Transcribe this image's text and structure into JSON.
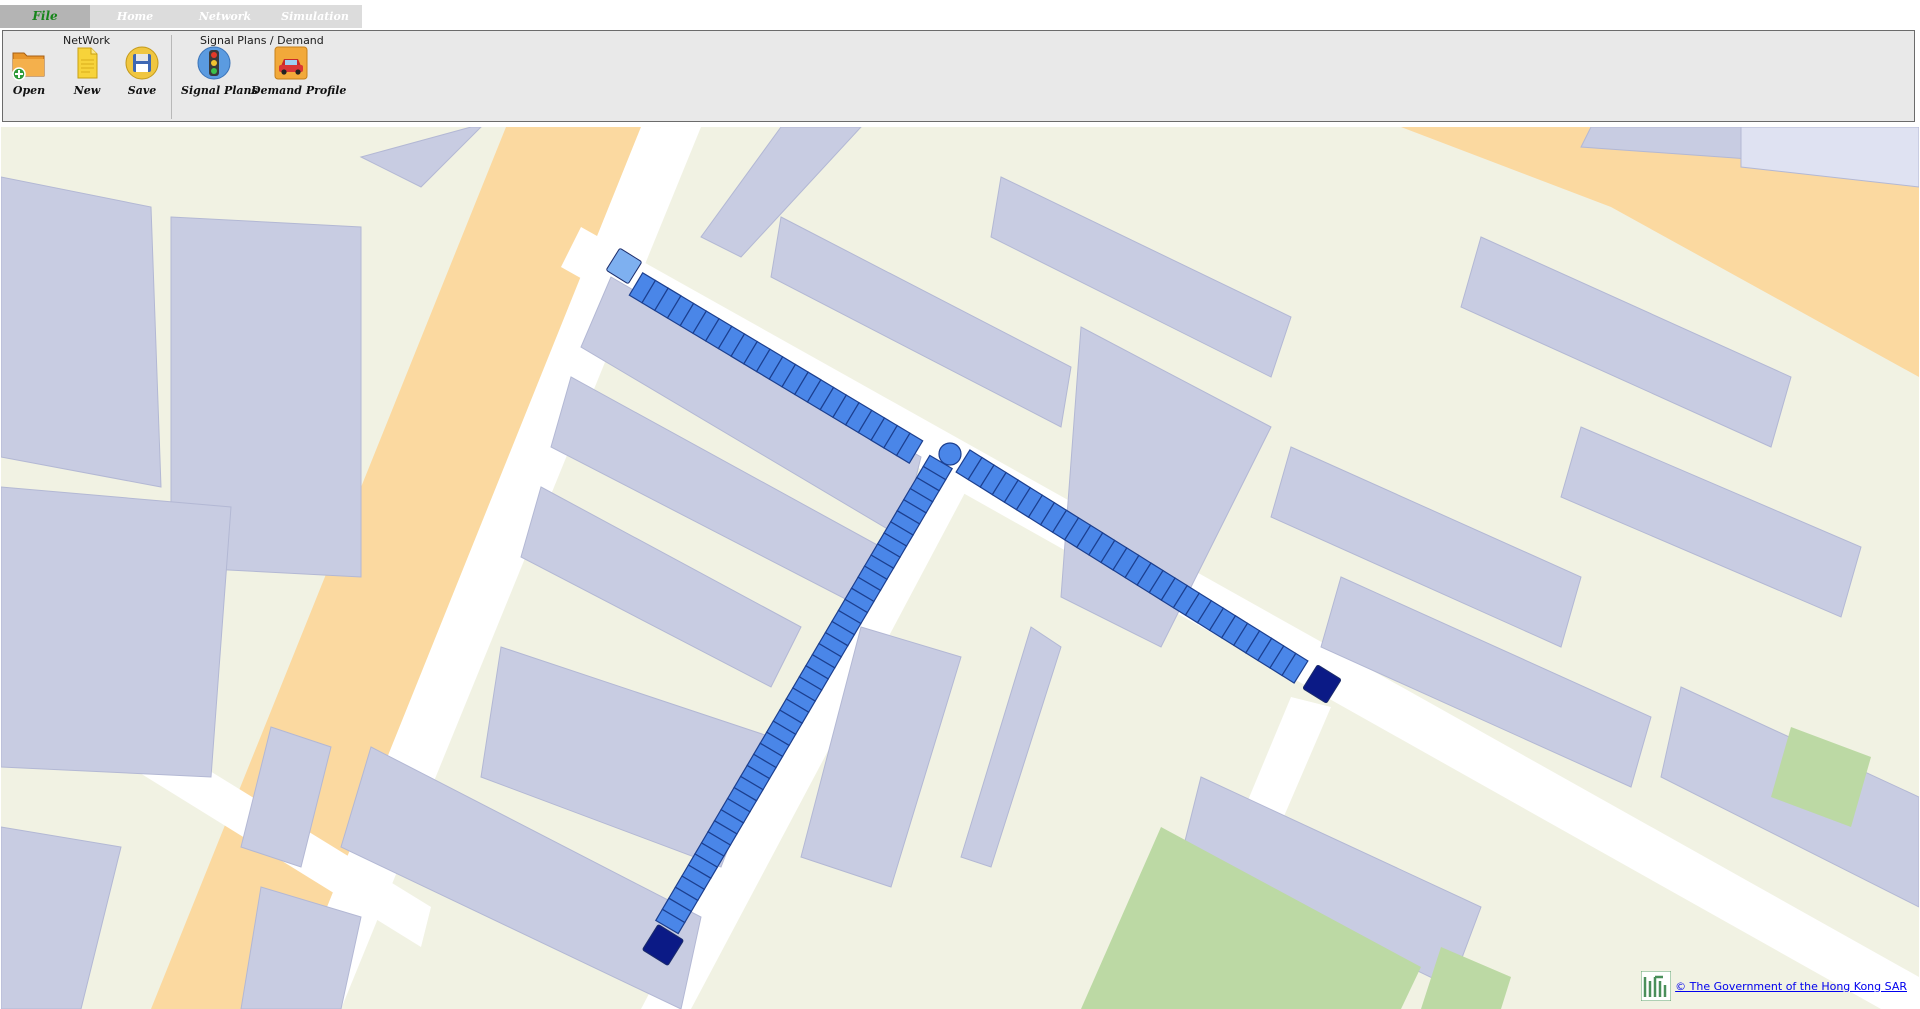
{
  "tabs": [
    {
      "label": "File",
      "active": true
    },
    {
      "label": "Home",
      "active": false
    },
    {
      "label": "Network",
      "active": false
    },
    {
      "label": "Simulation",
      "active": false
    }
  ],
  "ribbon": {
    "network_group": {
      "label": "NetWork",
      "buttons": [
        {
          "label": "Open",
          "icon": "open-folder-icon"
        },
        {
          "label": "New",
          "icon": "new-file-icon"
        },
        {
          "label": "Save",
          "icon": "save-disk-icon"
        }
      ]
    },
    "signal_group": {
      "label": "Signal Plans / Demand",
      "buttons": [
        {
          "label": "Signal Plans",
          "icon": "traffic-light-icon"
        },
        {
          "label": "Demand Profile",
          "icon": "car-icon"
        }
      ]
    }
  },
  "map": {
    "attribution": "© The Government of the Hong Kong SAR",
    "colors": {
      "ground": "#f1f2e3",
      "building": "#c8cce2",
      "building_edge": "#b3b8d4",
      "highway": "#fbd9a0",
      "park": "#bcd9a4",
      "lane_cell": "#4a86e8",
      "lane_edge": "#1c3f8f",
      "origin_node": "#0b1a86",
      "junction": "#4a86e8",
      "light_node": "#7eb0f0"
    }
  }
}
